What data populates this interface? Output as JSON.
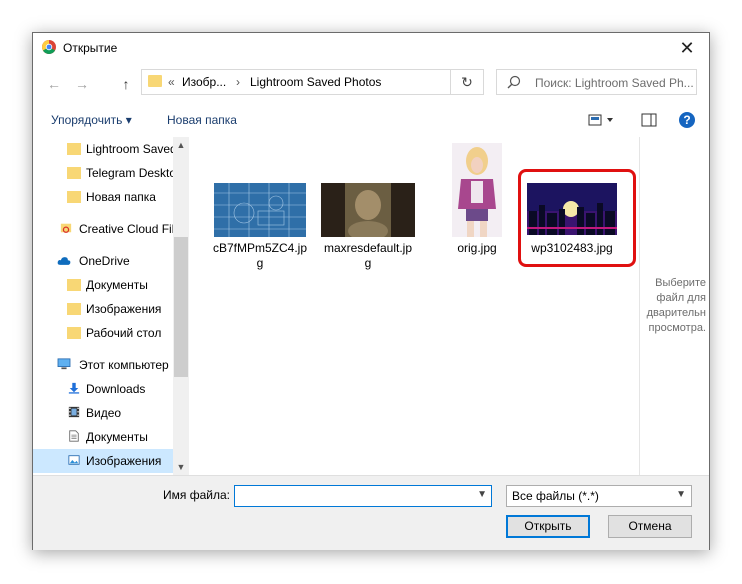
{
  "window": {
    "title": "Открытие",
    "close_glyph": "✕"
  },
  "address": {
    "back_glyph": "←",
    "forward_glyph": "→",
    "up_glyph": "↑",
    "chevrons": "«",
    "crumb1": "Изобр...",
    "sep": "›",
    "crumb2": "Lightroom Saved Photos",
    "refresh_glyph": "↻"
  },
  "search": {
    "placeholder": "Поиск: Lightroom Saved Ph..."
  },
  "toolbar": {
    "organize": "Упорядочить ▾",
    "new_folder": "Новая папка"
  },
  "sidebar": {
    "items": [
      {
        "label": "Lightroom Saved",
        "icon": "folder-icon"
      },
      {
        "label": "Telegram Deskto",
        "icon": "folder-icon"
      },
      {
        "label": "Новая папка",
        "icon": "folder-icon"
      },
      {
        "label": "Creative Cloud Fil",
        "icon": "creative-cloud-icon"
      },
      {
        "label": "OneDrive",
        "icon": "cloud-icon"
      },
      {
        "label": "Документы",
        "icon": "folder-icon"
      },
      {
        "label": "Изображения",
        "icon": "folder-icon"
      },
      {
        "label": "Рабочий стол",
        "icon": "folder-icon"
      },
      {
        "label": "Этот компьютер",
        "icon": "computer-icon"
      },
      {
        "label": "Downloads",
        "icon": "download-icon"
      },
      {
        "label": "Видео",
        "icon": "video-icon"
      },
      {
        "label": "Документы",
        "icon": "document-icon"
      },
      {
        "label": "Изображения",
        "icon": "pictures-icon"
      }
    ]
  },
  "files": [
    {
      "name": "cB7fMPm5ZC4.jpg",
      "line1": "cB7fMPm5ZC4.jp",
      "line2": "g"
    },
    {
      "name": "maxresdefault.jpg",
      "line1": "maxresdefault.jp",
      "line2": "g"
    },
    {
      "name": "orig.jpg",
      "line1": "orig.jpg",
      "line2": ""
    },
    {
      "name": "wp3102483.jpg",
      "line1": "wp3102483.jpg",
      "line2": ""
    }
  ],
  "preview": {
    "line1": "Выберите",
    "line2": "файл для",
    "line3": "дварительн",
    "line4": "просмотра."
  },
  "bottom": {
    "filename_label": "Имя файла:",
    "filename_value": "",
    "filetype": "Все файлы (*.*)",
    "open": "Открыть",
    "cancel": "Отмена"
  },
  "colors": {
    "accent": "#0078d7",
    "highlight": "#e01010",
    "folder": "#f8d775",
    "selection": "#cce8ff"
  }
}
